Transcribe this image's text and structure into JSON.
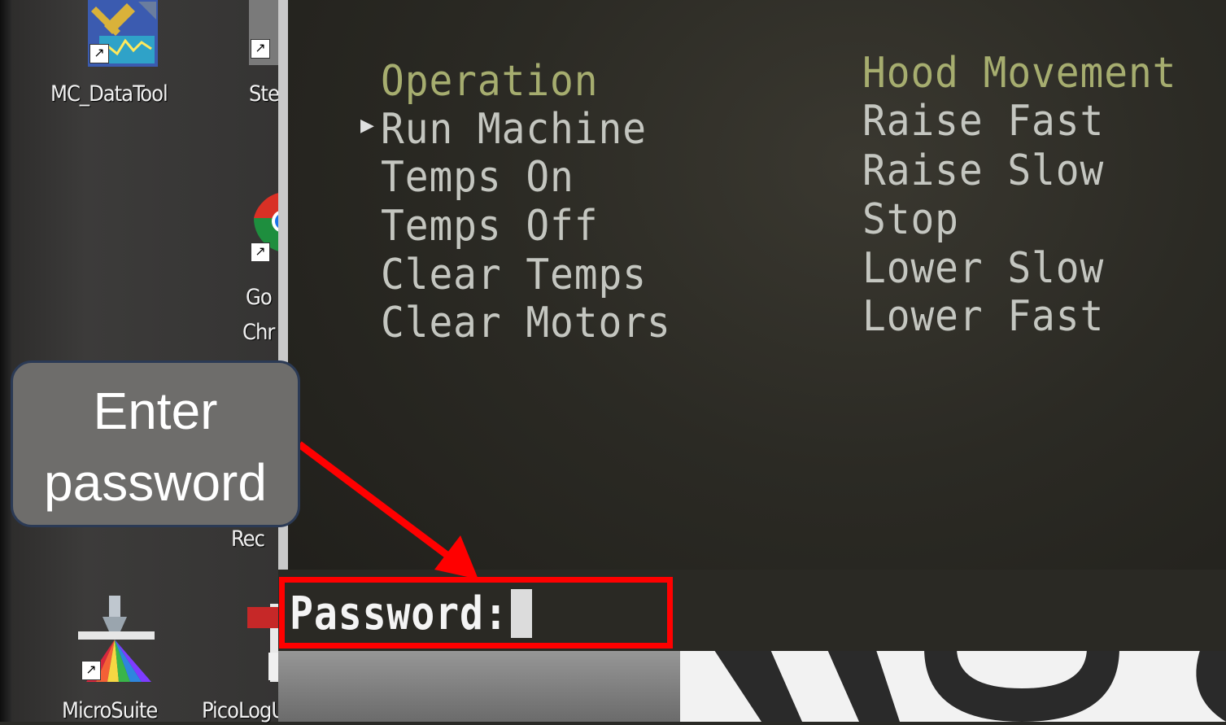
{
  "desktop": {
    "icons": [
      {
        "name": "mc-datatool-icon",
        "label": "MC_DataTool"
      },
      {
        "name": "st-icon",
        "label": "Ste"
      },
      {
        "name": "chrome-icon",
        "label_line1": "Go",
        "label_line2": "Chr"
      },
      {
        "name": "rec-icon",
        "label": "Rec"
      },
      {
        "name": "microsuite-icon",
        "label": "MicroSuite"
      },
      {
        "name": "picolog-icon",
        "label": "PicoLogUser..."
      }
    ]
  },
  "terminal": {
    "operation_menu": {
      "title": "Operation",
      "items": [
        "Run Machine",
        "Temps On",
        "Temps Off",
        "Clear Temps",
        "Clear Motors"
      ],
      "selected_index": 0
    },
    "hood_menu": {
      "title": "Hood Movement",
      "items": [
        "Raise Fast",
        "Raise Slow",
        "Stop",
        "Lower Slow",
        "Lower Fast"
      ]
    },
    "password_prompt": {
      "label": "Password:",
      "value": ""
    }
  },
  "callout": {
    "line1": "Enter",
    "line2": "password"
  },
  "colors": {
    "menu_title": "#a6ad6f",
    "menu_item": "#c4c6c0",
    "highlight": "#ff0000",
    "callout_bg": "#6e6d6b"
  }
}
